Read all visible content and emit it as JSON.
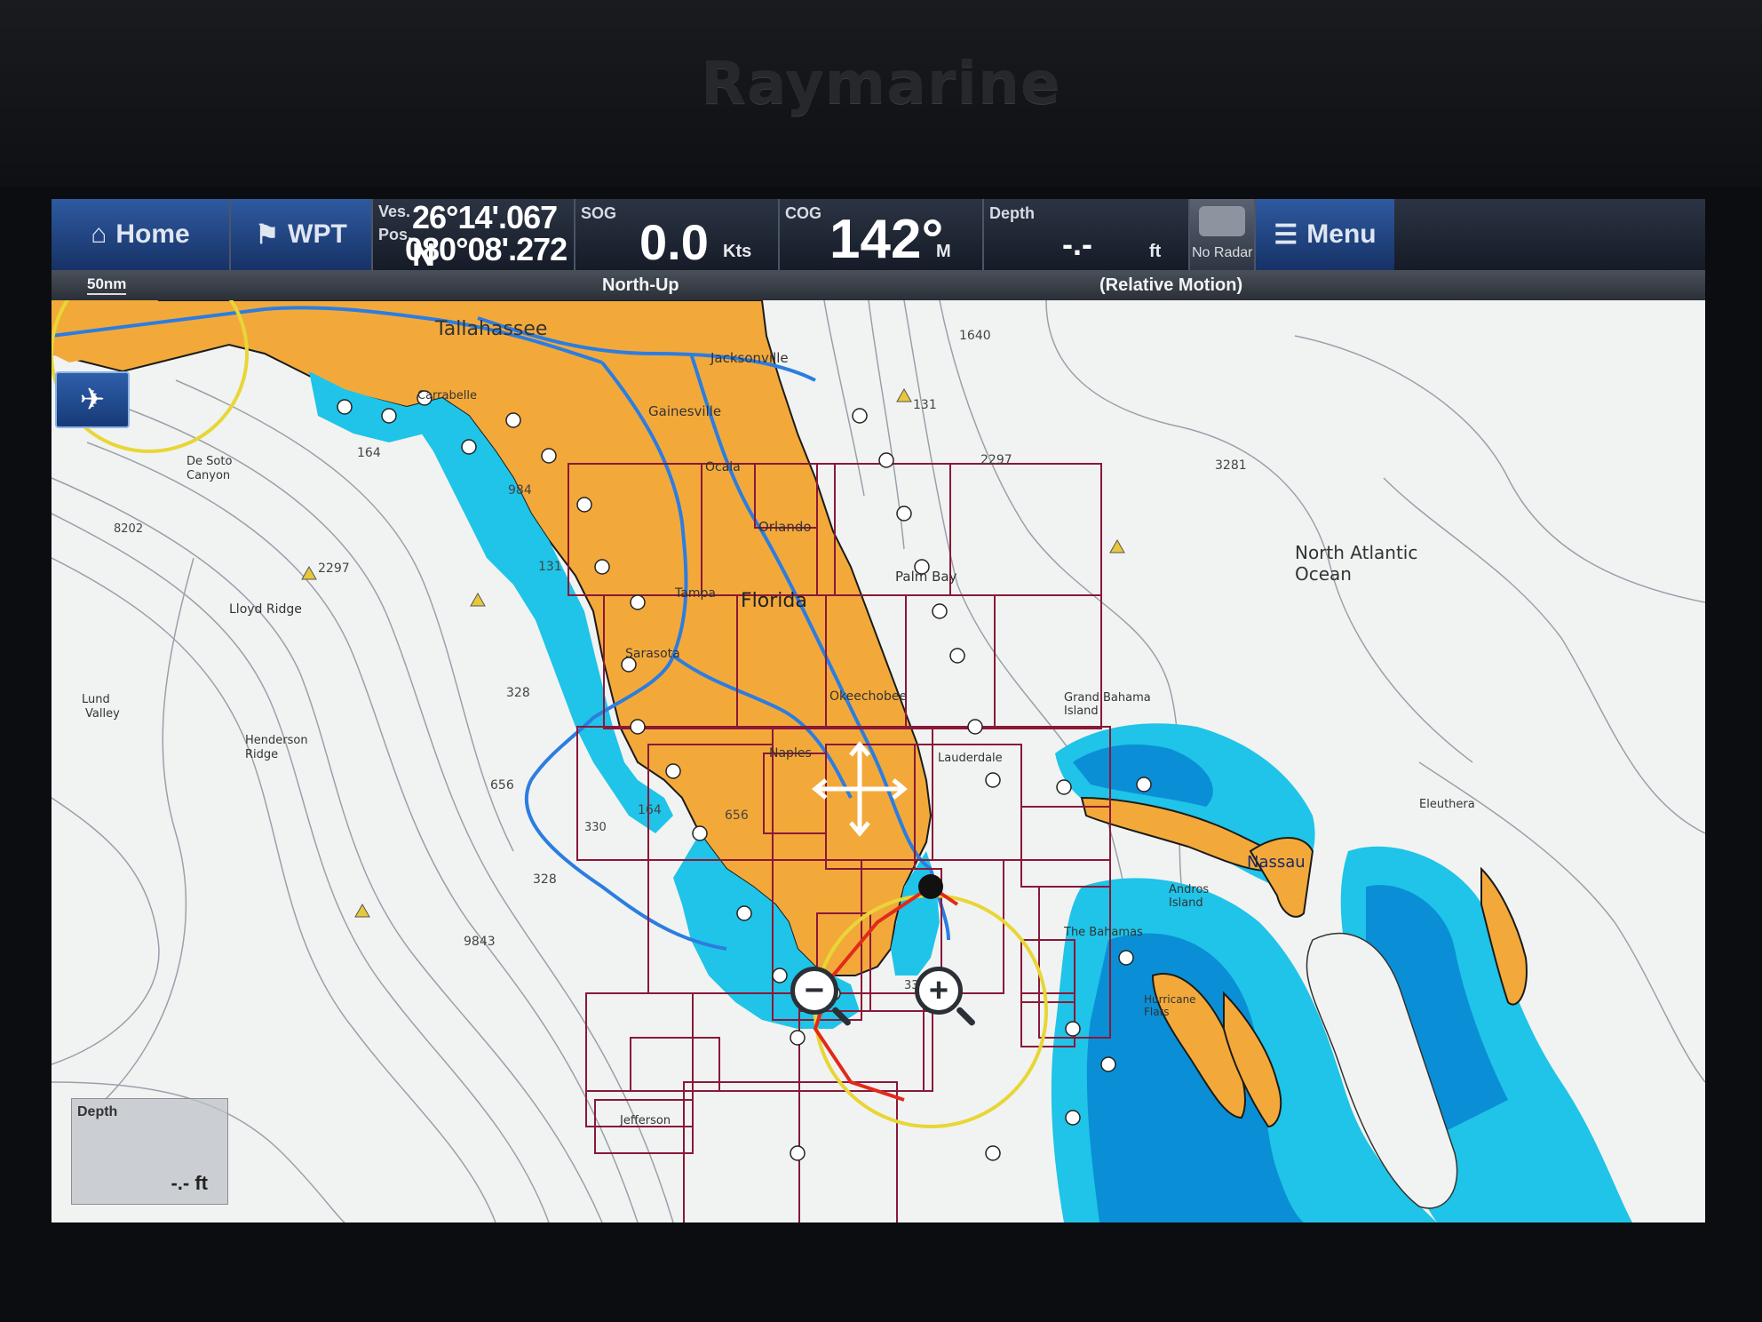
{
  "brand": "Raymarine",
  "topbar": {
    "home_label": "Home",
    "wpt_label": "WPT",
    "pos_label_1": "Ves.",
    "pos_label_2": "Pos.",
    "latitude": "26°14'.067 N",
    "longitude": "080°08'.272 W",
    "sog_label": "SOG",
    "sog_value": "0.0",
    "sog_unit": "Kts",
    "cog_label": "COG",
    "cog_value": "142°",
    "cog_unit": "M",
    "depth_label": "Depth",
    "depth_value": "-.-",
    "depth_unit": "ft",
    "radar_label": "No Radar",
    "menu_label": "Menu"
  },
  "status": {
    "range": "50nm",
    "orientation": "North-Up",
    "motion": "(Relative Motion)"
  },
  "map_labels": {
    "tallahassee": "Tallahassee",
    "jacksonville": "Jacksonville",
    "gainesville": "Gainesville",
    "ocala": "Ocala",
    "orlando": "Orlando",
    "palm_bay": "Palm Bay",
    "florida": "Florida",
    "tampa": "Tampa",
    "sarasota": "Sarasota",
    "naples": "Naples",
    "okeechobee": "Okeechobee",
    "lauderdale": "Lauderdale",
    "north_atlantic": "North Atlantic",
    "ocean": "Ocean",
    "nassau": "Nassau",
    "eleuthera": "Eleuthera",
    "andros": "Andros Island",
    "grand_bahama": "Grand Bahama Island",
    "the_bahamas": "The Bahamas",
    "hurricane_flats": "Hurricane Flats",
    "desoto": "De Soto",
    "canyon": "Canyon",
    "lloyd": "Lloyd Ridge",
    "lund": "Lund",
    "valley": "Valley",
    "henderson": "Henderson",
    "ridge": "Ridge",
    "jefferson": "Jefferson",
    "carrabelle": "Carrabelle",
    "d1640": "1640",
    "d131a": "131",
    "d2297a": "2297",
    "d3281": "3281",
    "d164": "164",
    "d984": "984",
    "d8202": "8202",
    "d2297b": "2297",
    "d131b": "131",
    "d328a": "328",
    "d656a": "656",
    "d164b": "164",
    "d656b": "656",
    "d328b": "328",
    "d9843": "9843",
    "d330": "330",
    "d3306": "3306"
  },
  "depth_box": {
    "label": "Depth",
    "value": "-.- ft"
  },
  "icons": {
    "home": "home-icon",
    "wpt": "waypoint-icon",
    "menu": "menu-icon",
    "radar": "radar-icon",
    "nav": "navigation-icon",
    "zoom_out": "zoom-out-icon",
    "zoom_in": "zoom-in-icon",
    "cursor": "move-cursor-icon"
  },
  "colors": {
    "land": "#f3a93a",
    "shallow": "#1fc4e8",
    "shallow_dark": "#0a8fd6",
    "deep": "#f1f3f2",
    "chart_box": "#8a1838",
    "route": "#2c7de0",
    "range_ring": "#e8d636",
    "heading": "#e22a1a"
  }
}
